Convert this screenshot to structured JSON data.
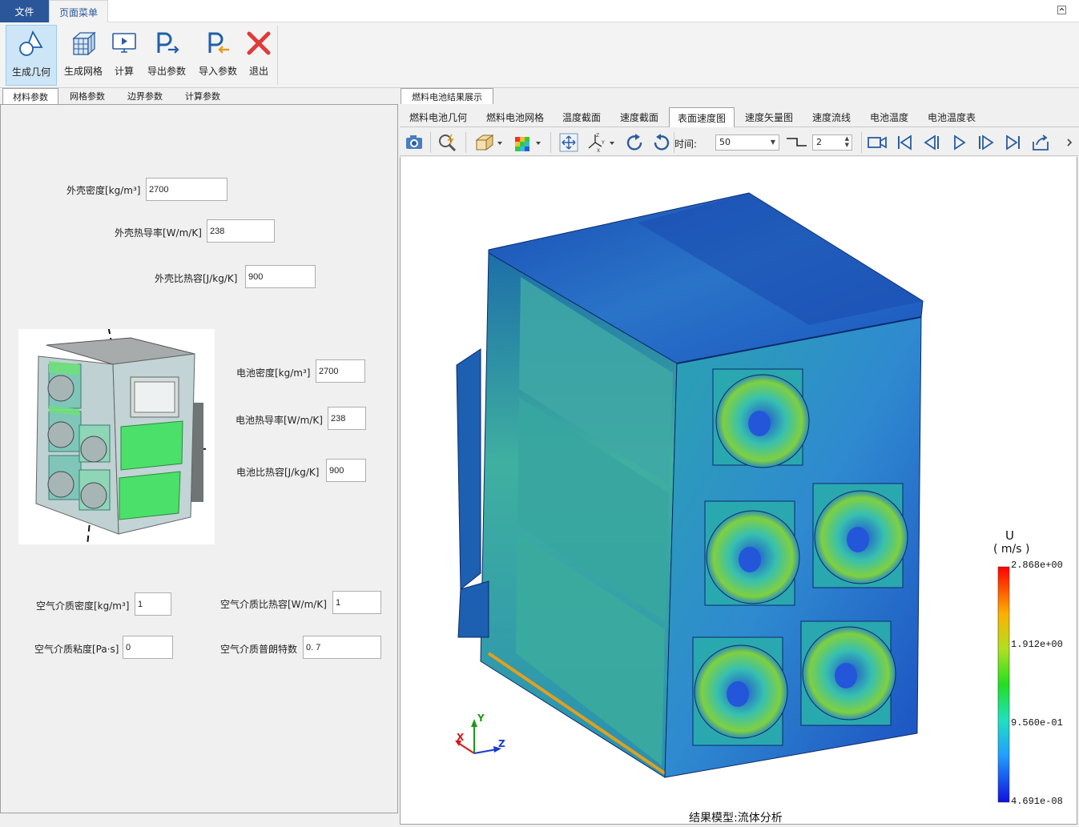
{
  "menu": {
    "file": "文件",
    "page_menu": "页面菜单"
  },
  "ribbon": {
    "buttons": [
      {
        "label": "生成几何",
        "icon": "geometry-icon"
      },
      {
        "label": "生成网格",
        "icon": "mesh-icon"
      },
      {
        "label": "计算",
        "icon": "compute-icon"
      },
      {
        "label": "导出参数",
        "icon": "export-params-icon"
      },
      {
        "label": "导入参数",
        "icon": "import-params-icon"
      },
      {
        "label": "退出",
        "icon": "exit-icon"
      }
    ]
  },
  "left_tabs": [
    "材料参数",
    "网格参数",
    "边界参数",
    "计算参数"
  ],
  "fields": {
    "shell_density": {
      "label": "外壳密度[kg/m³]",
      "value": "2700"
    },
    "shell_conductivity": {
      "label": "外壳热导率[W/m/K]",
      "value": "238"
    },
    "shell_heat_capacity": {
      "label": "外壳比热容[J/kg/K]",
      "value": "900"
    },
    "battery_density": {
      "label": "电池密度[kg/m³]",
      "value": "2700"
    },
    "battery_conductivity": {
      "label": "电池热导率[W/m/K]",
      "value": "238"
    },
    "battery_heat_capacity": {
      "label": "电池比热容[J/kg/K]",
      "value": "900"
    },
    "air_density": {
      "label": "空气介质密度[kg/m³]",
      "value": "1"
    },
    "air_heat_capacity": {
      "label": "空气介质比热容[W/m/K]",
      "value": "1"
    },
    "air_viscosity": {
      "label": "空气介质粘度[Pa·s]",
      "value": "0"
    },
    "air_prandtl": {
      "label": "空气介质普朗特数",
      "value": "0. 7"
    }
  },
  "results": {
    "title_tab": "燃料电池结果展示",
    "tabs": [
      "燃料电池几何",
      "燃料电池网格",
      "温度截面",
      "速度截面",
      "表面速度图",
      "速度矢量图",
      "速度流线",
      "电池温度",
      "电池温度表"
    ],
    "active_tab": "表面速度图"
  },
  "toolbar": {
    "time_label": "时间:",
    "time_value": "50",
    "step_value": "2"
  },
  "legend": {
    "variable": "U",
    "unit": "( m/s )",
    "max": "2.868e+00",
    "mid_high": "1.912e+00",
    "mid_low": "9.560e-01",
    "min": "4.691e-08"
  },
  "axes": {
    "x": "X",
    "y": "Y",
    "z": "Z"
  },
  "status": "结果模型:流体分析",
  "colors": {
    "accent": "#2b579a",
    "active_ribbon": "#cde6f7"
  }
}
